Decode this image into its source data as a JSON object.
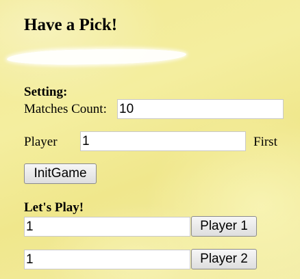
{
  "page": {
    "title": "Have a Pick!"
  },
  "setting": {
    "heading": "Setting:",
    "matches_label": "Matches Count:",
    "matches_value": "10",
    "player_label": "Player",
    "player_value": "1",
    "first_label": "First",
    "init_button": "InitGame"
  },
  "play": {
    "heading": "Let's Play!",
    "player1_value": "1",
    "player1_button": "Player 1",
    "player2_value": "1",
    "player2_button": "Player 2"
  }
}
